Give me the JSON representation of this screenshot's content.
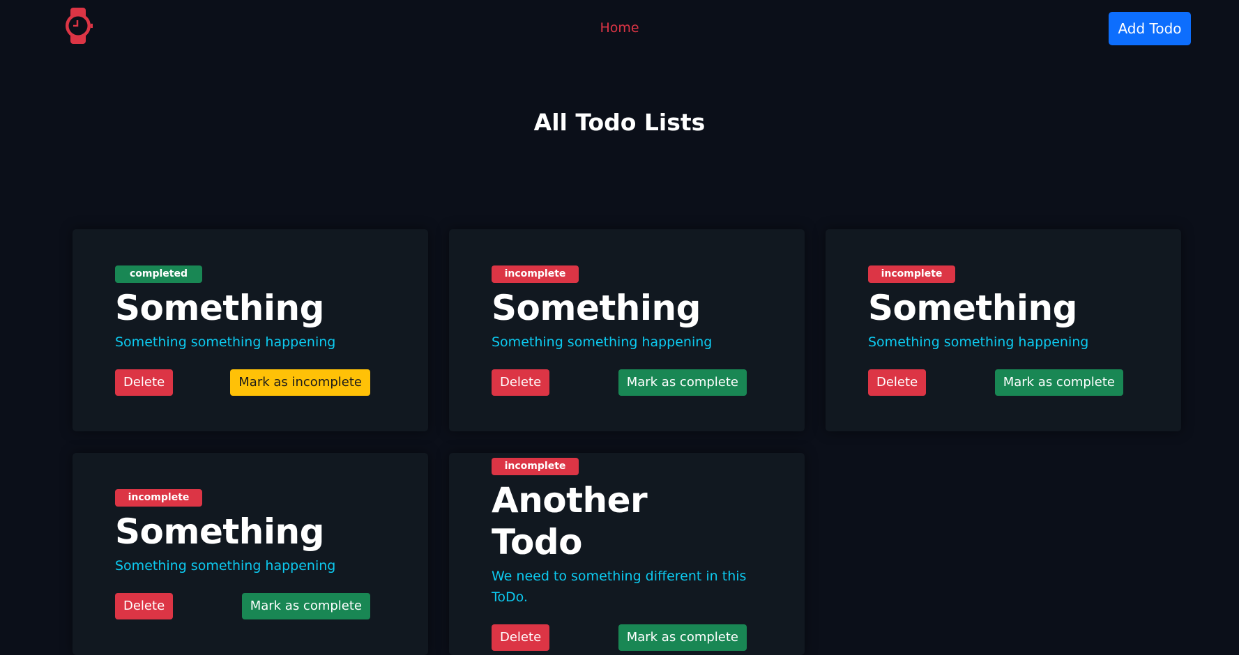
{
  "nav": {
    "home_label": "Home",
    "add_label": "Add Todo",
    "logo_icon": "watch-icon"
  },
  "page_title": "All Todo Lists",
  "colors": {
    "accent": "#dc3545",
    "primary": "#0d6efd",
    "success": "#198754",
    "warning": "#ffc107",
    "info": "#0dcaf0"
  },
  "todos": [
    {
      "status": "completed",
      "title": "Something",
      "description": "Something something happening",
      "delete_label": "Delete",
      "toggle_label": "Mark as incomplete"
    },
    {
      "status": "incomplete",
      "title": "Something",
      "description": "Something something happening",
      "delete_label": "Delete",
      "toggle_label": "Mark as complete"
    },
    {
      "status": "incomplete",
      "title": "Something",
      "description": "Something something happening",
      "delete_label": "Delete",
      "toggle_label": "Mark as complete"
    },
    {
      "status": "incomplete",
      "title": "Something",
      "description": "Something something happening",
      "delete_label": "Delete",
      "toggle_label": "Mark as complete"
    },
    {
      "status": "incomplete",
      "title": "Another Todo",
      "description": "We need to something different in this ToDo.",
      "delete_label": "Delete",
      "toggle_label": "Mark as complete"
    }
  ]
}
